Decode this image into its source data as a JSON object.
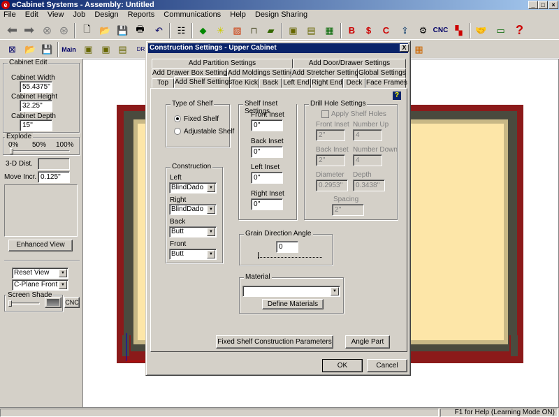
{
  "app": {
    "title": "eCabinet Systems - Assembly: Untitled",
    "logo_letter": "e"
  },
  "menu": [
    "File",
    "Edit",
    "View",
    "Job",
    "Design",
    "Reports",
    "Communications",
    "Help",
    "Design Sharing"
  ],
  "toolbar": {
    "cnc_label": "CNC",
    "main_label": "Main",
    "dr_label": "DR"
  },
  "left_panel": {
    "group_title": "Cabinet Edit",
    "width_label": "Cabinet Width",
    "width_value": "55.4375''",
    "height_label": "Cabinet Height",
    "height_value": "32.25''",
    "depth_label": "Cabinet Depth",
    "depth_value": "15''",
    "explode_title": "Explode",
    "explode_ticks": [
      "0%",
      "50%",
      "100%"
    ],
    "dist_label": "3-D Dist.",
    "move_label": "Move Incr.",
    "move_value": "0.125''",
    "enhanced_button": "Enhanced View",
    "reset_view": "Reset View",
    "cplane": "C-Plane Front",
    "screen_shade": "Screen Shade",
    "cnc_button": "CNC"
  },
  "dialog": {
    "title": "Construction Settings - Upper Cabinet",
    "close": "X",
    "tabs_row1": [
      "Add Partition Settings",
      "Add Door/Drawer Settings"
    ],
    "tabs_row2": [
      "Add Drawer Box Settings",
      "Add Moldings Settings",
      "Add Stretcher Settings",
      "Global Settings"
    ],
    "tabs_row3": [
      "Top",
      "Add Shelf Settings",
      "Toe Kick",
      "Back",
      "Left End",
      "Right End",
      "Deck",
      "Face Frames"
    ],
    "help": "?",
    "type_of_shelf": {
      "title": "Type of Shelf",
      "fixed": "Fixed Shelf",
      "adjustable": "Adjustable Shelf",
      "selected": "fixed"
    },
    "shelf_inset": {
      "title": "Shelf Inset Settings",
      "front_label": "Front Inset",
      "front_value": "0''",
      "back_label": "Back Inset",
      "back_value": "0''",
      "left_label": "Left Inset",
      "left_value": "0''",
      "right_label": "Right Inset",
      "right_value": "0''"
    },
    "drill_hole": {
      "title": "Drill Hole Settings",
      "apply_label": "Apply Shelf Holes",
      "front_inset_label": "Front Inset",
      "front_inset_value": "2''",
      "number_up_label": "Number Up",
      "number_up_value": "4",
      "back_inset_label": "Back Inset",
      "back_inset_value": "2''",
      "number_down_label": "Number Down",
      "number_down_value": "4",
      "diameter_label": "Diameter",
      "diameter_value": "0.2953''",
      "depth_label": "Depth",
      "depth_value": "0.3438''",
      "spacing_label": "Spacing",
      "spacing_value": "2''"
    },
    "construction": {
      "title": "Construction",
      "left_label": "Left",
      "left_value": "BlindDado",
      "right_label": "Right",
      "right_value": "BlindDado",
      "back_label": "Back",
      "back_value": "Butt",
      "front_label": "Front",
      "front_value": "Butt"
    },
    "grain": {
      "title": "Grain Direction Angle",
      "value": "0"
    },
    "material": {
      "title": "Material",
      "value": "",
      "define_button": "Define Materials"
    },
    "fixed_params_button": "Fixed Shelf Construction Parameters",
    "angle_part_button": "Angle Part",
    "ok_button": "OK",
    "cancel_button": "Cancel"
  },
  "status": {
    "help_text": "F1 for Help (Learning Mode ON)"
  },
  "colors": {
    "frame_red": "#8b1a1a",
    "panel_gray": "#4a4a3e",
    "panel_cream": "#fde6a8",
    "title_blue": "#0a246a"
  }
}
